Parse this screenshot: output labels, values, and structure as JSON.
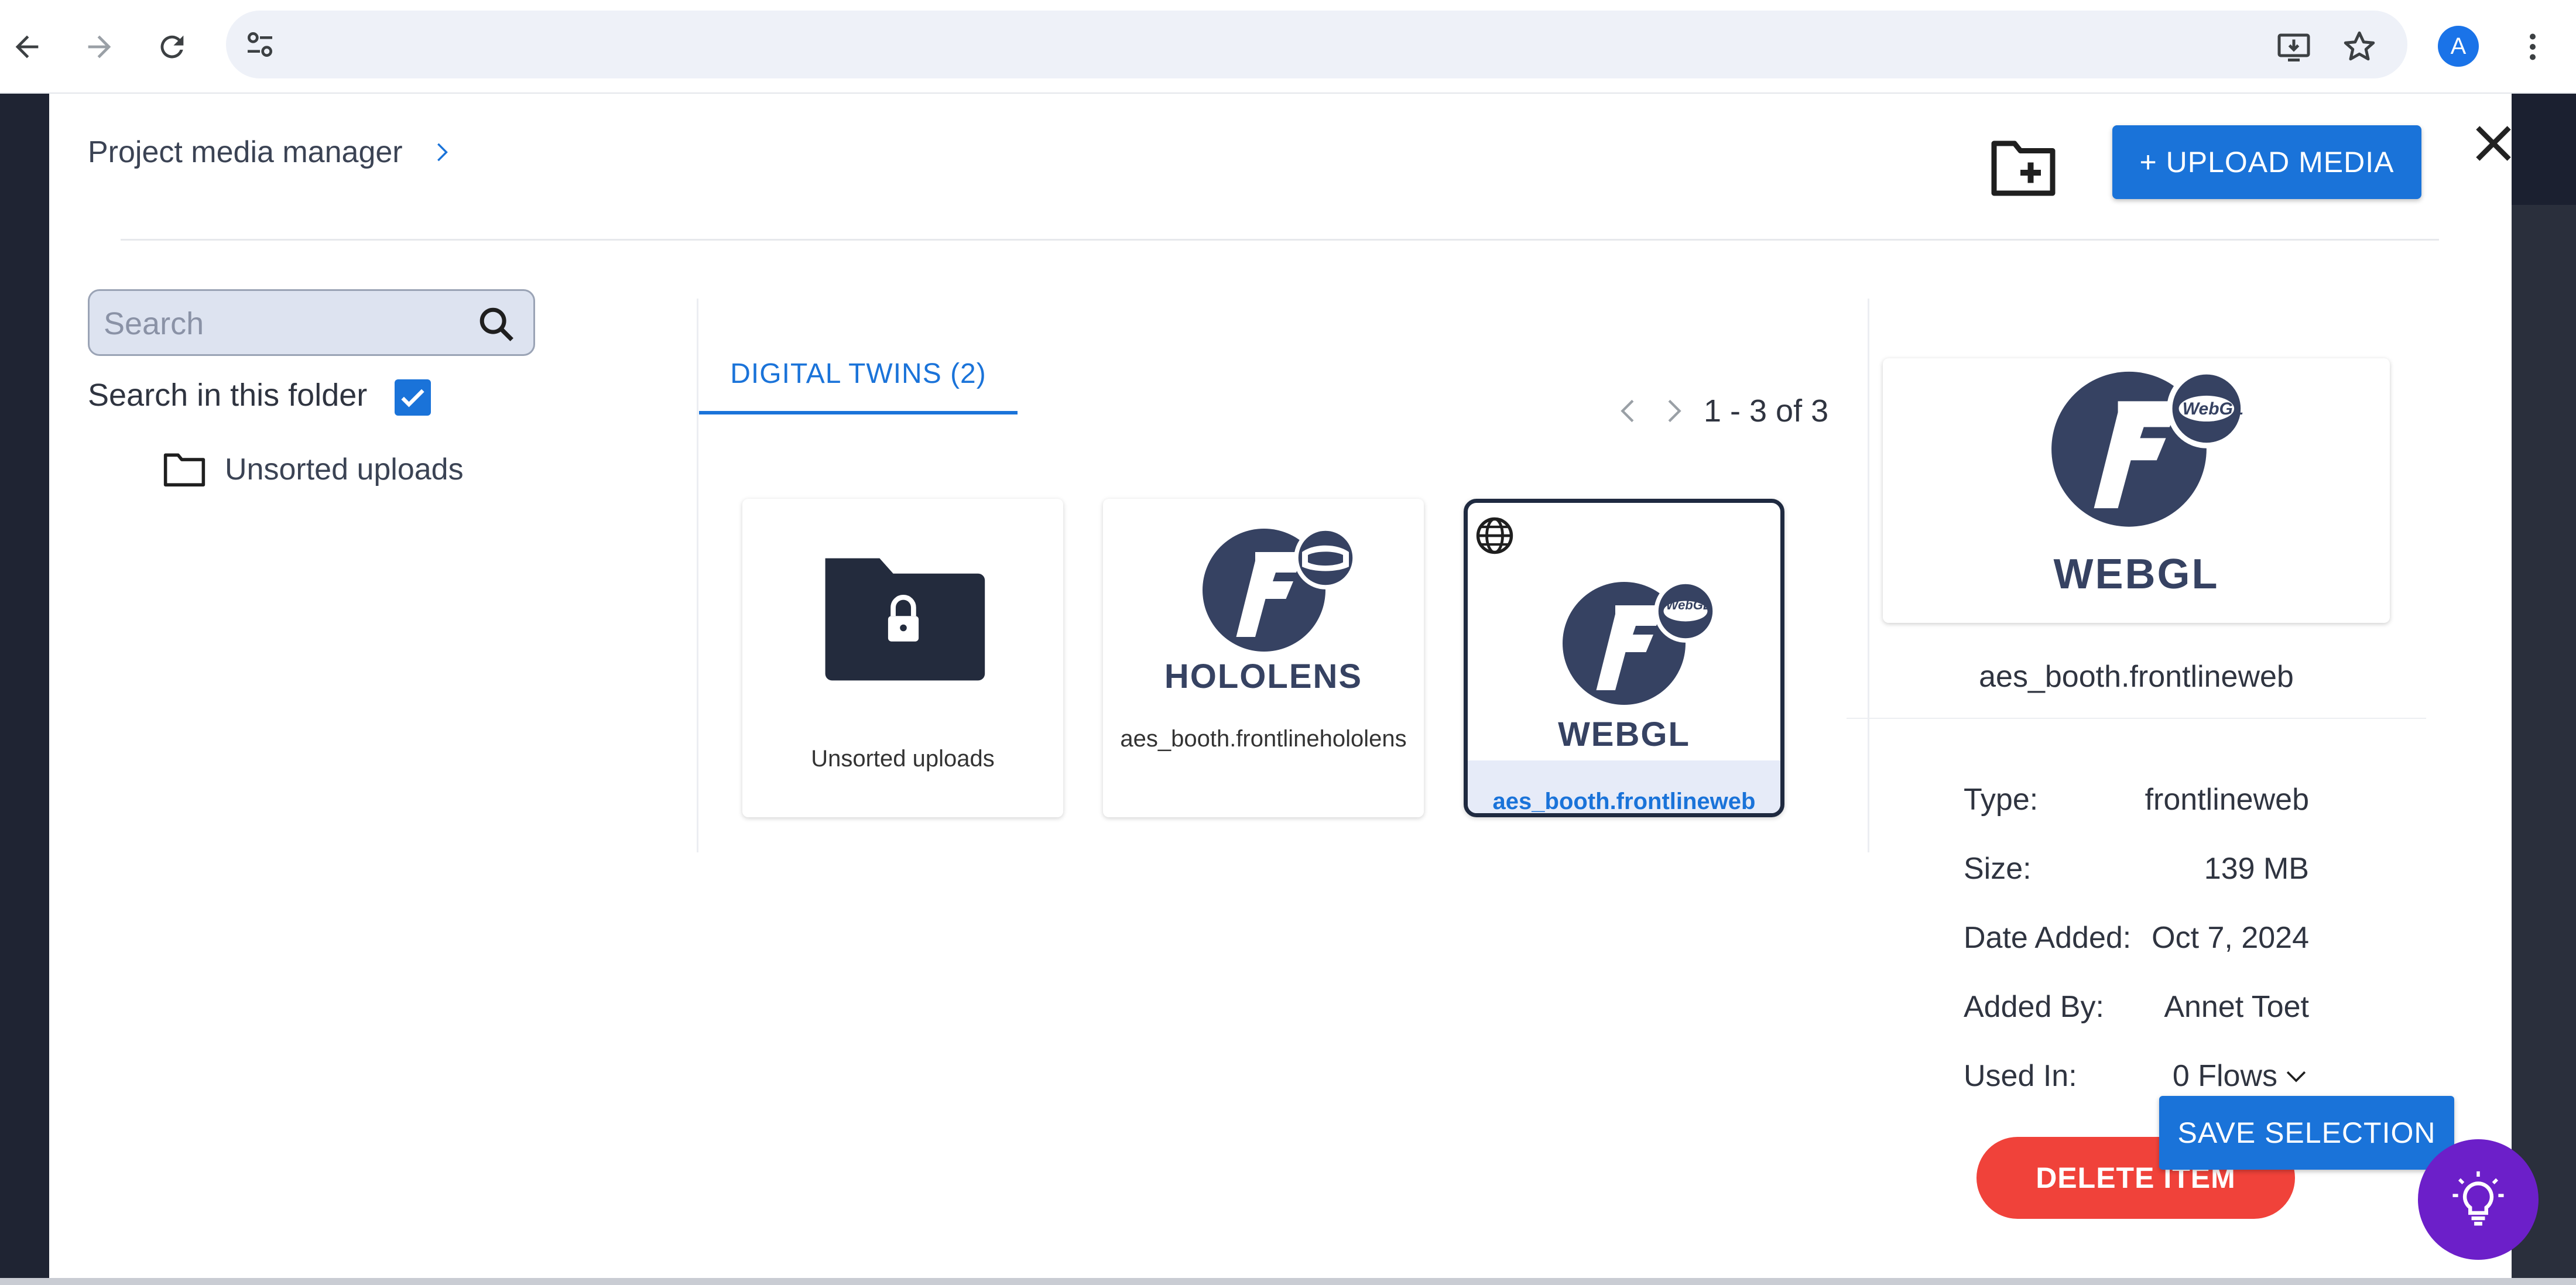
{
  "browser": {
    "avatar_letter": "A"
  },
  "dialog": {
    "breadcrumb": "Project media manager",
    "upload_label": "+ UPLOAD MEDIA"
  },
  "search": {
    "placeholder": "Search",
    "value": "",
    "in_folder_label": "Search in this folder",
    "in_folder_checked": true
  },
  "folders": [
    {
      "label": "Unsorted uploads"
    }
  ],
  "tab": {
    "label": "DIGITAL TWINS (2)"
  },
  "pagination": {
    "range": "1 - 3 of 3"
  },
  "cards": [
    {
      "name": "Unsorted uploads",
      "kind": "locked-folder"
    },
    {
      "name": "aes_booth.frontlinehololens",
      "kind": "hololens",
      "logo_text": "HOLOLENS"
    },
    {
      "name": "aes_booth.frontlineweb",
      "kind": "webgl",
      "logo_text": "WEBGL",
      "badge": "WebGL",
      "selected": true
    }
  ],
  "detail": {
    "logo_text": "WEBGL",
    "badge": "WebGL",
    "name": "aes_booth.frontlineweb",
    "rows": [
      {
        "label": "Type:",
        "value": "frontlineweb"
      },
      {
        "label": "Size:",
        "value": "139 MB"
      },
      {
        "label": "Date Added:",
        "value": "Oct 7, 2024"
      },
      {
        "label": "Added By:",
        "value": "Annet Toet"
      },
      {
        "label": "Used In:",
        "value": "0 Flows"
      }
    ],
    "delete_label": "DELETE ITEM",
    "save_label": "SAVE SELECTION"
  },
  "colors": {
    "primary": "#1a73d9",
    "danger": "#f0423a",
    "logo_navy": "#364262",
    "help_fab": "#6c1fc9"
  }
}
